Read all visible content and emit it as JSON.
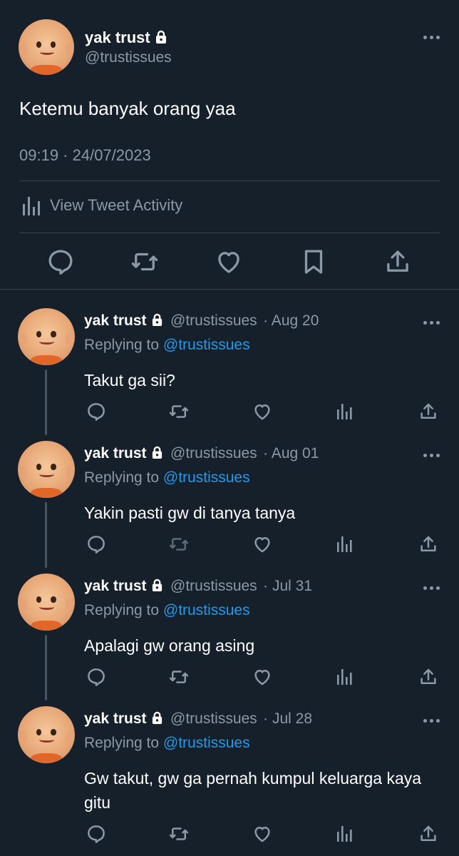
{
  "main": {
    "name": "yak trust",
    "handle": "@trustissues",
    "text": "Ketemu banyak orang yaa",
    "timestamp": "09:19 · 24/07/2023",
    "activity_label": "View Tweet Activity"
  },
  "replies": [
    {
      "name": "yak trust",
      "handle": "@trustissues",
      "date": "· Aug 20",
      "replying_prefix": "Replying to ",
      "replying_to": "@trustissues",
      "text": "Takut ga sii?"
    },
    {
      "name": "yak trust",
      "handle": "@trustissues",
      "date": "· Aug 01",
      "replying_prefix": "Replying to ",
      "replying_to": "@trustissues",
      "text": "Yakin pasti gw di tanya tanya"
    },
    {
      "name": "yak trust",
      "handle": "@trustissues",
      "date": "· Jul 31",
      "replying_prefix": "Replying to ",
      "replying_to": "@trustissues",
      "text": "Apalagi gw orang asing"
    },
    {
      "name": "yak trust",
      "handle": "@trustissues",
      "date": "· Jul 28",
      "replying_prefix": "Replying to ",
      "replying_to": "@trustissues",
      "text": "Gw takut, gw ga pernah kumpul keluarga kaya gitu"
    }
  ],
  "icons": [
    "lock-icon",
    "more-icon",
    "analytics-icon",
    "reply-icon",
    "retweet-icon",
    "like-icon",
    "bookmark-icon",
    "share-icon"
  ],
  "colors": {
    "background": "#15202b",
    "text": "#ffffff",
    "secondary": "#8b98a5",
    "link": "#1d9bf0",
    "divider": "#38444d"
  }
}
